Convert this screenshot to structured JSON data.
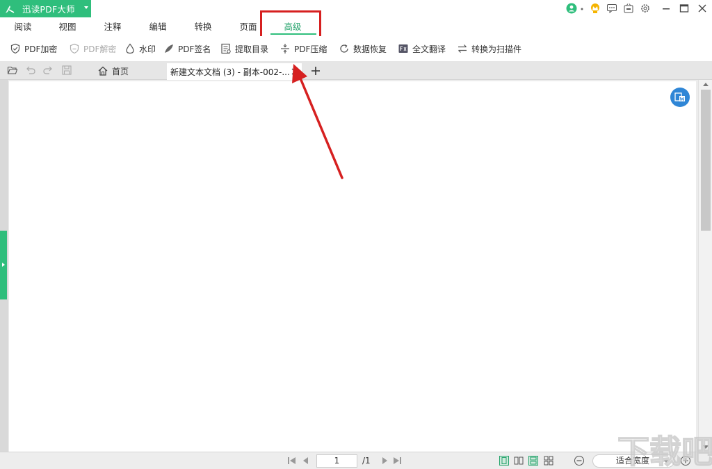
{
  "app": {
    "name": "迅读PDF大师"
  },
  "menu_tabs": [
    {
      "label": "阅读"
    },
    {
      "label": "视图"
    },
    {
      "label": "注释"
    },
    {
      "label": "编辑"
    },
    {
      "label": "转换"
    },
    {
      "label": "页面"
    },
    {
      "label": "高级",
      "active": true
    }
  ],
  "toolbar": {
    "items": [
      {
        "label": "PDF加密",
        "icon": "shield-check-icon"
      },
      {
        "label": "PDF解密",
        "icon": "shield-icon",
        "disabled": true
      },
      {
        "label": "水印",
        "icon": "droplet-icon"
      },
      {
        "label": "PDF签名",
        "icon": "feather-icon"
      },
      {
        "label": "提取目录",
        "icon": "document-list-icon"
      },
      {
        "label": "PDF压缩",
        "icon": "compress-icon"
      },
      {
        "label": "数据恢复",
        "icon": "refresh-icon"
      },
      {
        "label": "全文翻译",
        "icon": "translate-icon"
      },
      {
        "label": "转换为扫描件",
        "icon": "swap-arrows-icon"
      }
    ]
  },
  "document_tabs": {
    "home_label": "首页",
    "active_doc_label": "新建文本文档 (3) - 副本-002-..."
  },
  "statusbar": {
    "current_page": "1",
    "total_pages": "/1",
    "zoom_mode": "适合宽度"
  },
  "watermark": {
    "text": "下载吧"
  },
  "colors": {
    "brand_green": "#2fbe7c",
    "annotation_red": "#d62020",
    "float_button_blue": "#2f86d6"
  }
}
